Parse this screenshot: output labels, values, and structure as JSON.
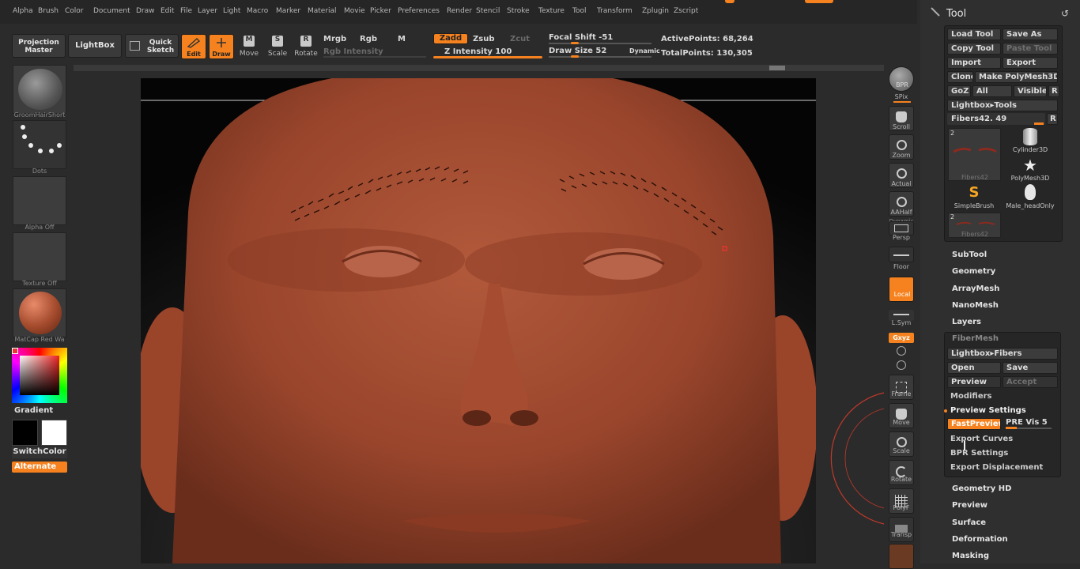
{
  "menu": [
    "Alpha",
    "Brush",
    "Color",
    "Document",
    "Draw",
    "Edit",
    "File",
    "Layer",
    "Light",
    "Macro",
    "Marker",
    "Material",
    "Movie",
    "Picker",
    "Preferences",
    "Render",
    "Stencil",
    "Stroke",
    "Texture",
    "Tool",
    "Transform",
    "Zplugin",
    "Zscript"
  ],
  "toolbar": {
    "projection_master": "Projection Master",
    "lightbox": "LightBox",
    "quick_sketch": "Quick Sketch",
    "edit": "Edit",
    "draw": "Draw",
    "move": "Move",
    "scale": "Scale",
    "rotate": "Rotate",
    "mrgb": "Mrgb",
    "rgb": "Rgb",
    "m": "M",
    "rgb_intensity": "Rgb Intensity",
    "zadd": "Zadd",
    "zsub": "Zsub",
    "zcut": "Zcut",
    "z_intensity": "Z Intensity 100",
    "focal_shift": "Focal Shift -51",
    "draw_size": "Draw Size 52",
    "dynamic": "Dynamic",
    "active_points": "ActivePoints: 68,264",
    "total_points": "TotalPoints: 130,305"
  },
  "left_shelf": {
    "brush_label": "GroomHairShort",
    "stroke_label": "Dots",
    "alpha_label": "Alpha Off",
    "texture_label": "Texture Off",
    "material_label": "MatCap Red Wa",
    "gradient": "Gradient",
    "switch_color": "SwitchColor",
    "alternate": "Alternate"
  },
  "right_shelf": {
    "bpr": "BPR",
    "spix": "SPix",
    "scroll": "Scroll",
    "zoom": "Zoom",
    "actual": "Actual",
    "aahalf": "AAHalf",
    "dynamic": "Dynamic",
    "persp": "Persp",
    "floor": "Floor",
    "local": "Local",
    "lsym": "L.Sym",
    "xyz": "Gxyz",
    "frame": "Frame",
    "move": "Move",
    "scale": "Scale",
    "rotate": "Rotate",
    "polyf": "PolyF",
    "transp": "Transp"
  },
  "tool_panel": {
    "title": "Tool",
    "load_tool": "Load Tool",
    "save_as": "Save As",
    "copy_tool": "Copy Tool",
    "paste_tool": "Paste Tool",
    "import": "Import",
    "export": "Export",
    "clone": "Clone",
    "make_polymesh": "Make PolyMesh3D",
    "goz": "GoZ",
    "all": "All",
    "visible": "Visible",
    "r": "R",
    "lightbox_tools": "Lightbox▸Tools",
    "fibers_slider": "Fibers42. 49",
    "tools": [
      {
        "name": "Fibers42",
        "count": "2"
      },
      {
        "name": "Cylinder3D"
      },
      {
        "name": "PolyMesh3D"
      },
      {
        "name": "SimpleBrush"
      },
      {
        "name": "Male_headOnly"
      },
      {
        "name": "Fibers42",
        "count": "2"
      }
    ],
    "sections": [
      "SubTool",
      "Geometry",
      "ArrayMesh",
      "NanoMesh",
      "Layers"
    ],
    "fibermesh": {
      "title": "FiberMesh",
      "lightbox_fibers": "Lightbox▸Fibers",
      "open": "Open",
      "save": "Save",
      "preview": "Preview",
      "accept": "Accept",
      "modifiers": "Modifiers",
      "preview_settings": "Preview Settings",
      "fast_preview": "FastPreview",
      "pre_vis": "PRE Vis 5",
      "export_curves": "Export Curves",
      "bpr_settings": "BPR Settings",
      "export_displacement": "Export Displacement"
    },
    "lower_sections": [
      "Geometry HD",
      "Preview",
      "Surface",
      "Deformation",
      "Masking"
    ]
  }
}
